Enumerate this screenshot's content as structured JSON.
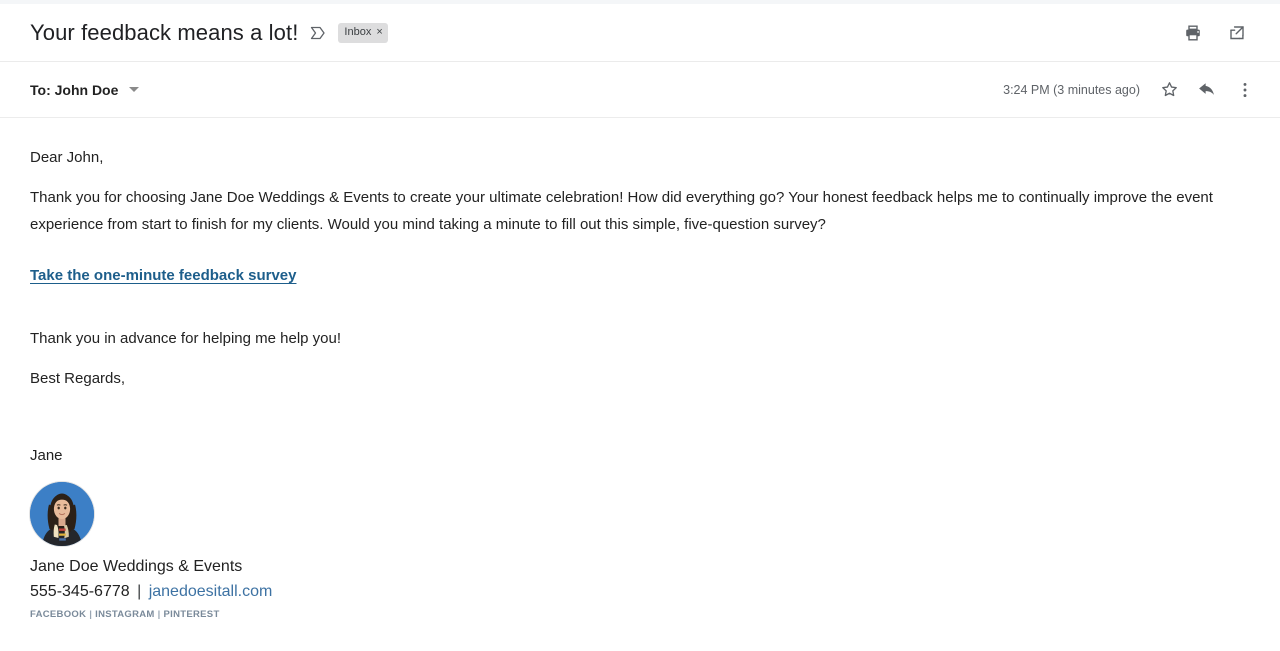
{
  "header": {
    "subject": "Your feedback means a lot!",
    "sent_icon": "sent-arrow-icon",
    "label": {
      "text": "Inbox",
      "remove": "×"
    },
    "actions": [
      {
        "name": "print-icon",
        "label": "Print"
      },
      {
        "name": "open-in-new-window-icon",
        "label": "Open in new window"
      }
    ]
  },
  "recipient": {
    "to_line": "To: John Doe",
    "expand_icon": "chevron-down-icon",
    "timestamp": "3:24 PM (3 minutes ago)",
    "actions": [
      {
        "name": "star-icon",
        "label": "Star"
      },
      {
        "name": "reply-icon",
        "label": "Reply"
      },
      {
        "name": "more-options-icon",
        "label": "More"
      }
    ]
  },
  "message": {
    "greeting": "Dear John,",
    "paragraph1": "Thank you for choosing Jane Doe Weddings & Events to create your ultimate celebration! How did everything go? Your honest feedback helps me to continually improve the event experience from start to finish for my clients. Would you mind taking a minute to fill out this simple, five-question survey?",
    "survey_link": "Take the one-minute feedback survey",
    "paragraph2": "Thank you in advance for helping me help you!",
    "closing": "Best Regards,",
    "sign_off": "Jane"
  },
  "signature": {
    "avatar_name": "avatar",
    "business_name": "Jane Doe Weddings & Events",
    "phone": "555-345-6778",
    "separator": "|",
    "website": "janedoesitall.com",
    "social": [
      "FACEBOOK",
      "INSTAGRAM",
      "PINTEREST"
    ],
    "social_separator": "|"
  },
  "colors": {
    "link": "#1d5e8b",
    "site_link": "#3d72a3",
    "text": "#222222",
    "muted": "#5f6368",
    "chip_bg": "#ddddde",
    "avatar_bg": "#3c7fc6",
    "social": "#7a8a9a",
    "divider": "#ebebeb"
  }
}
